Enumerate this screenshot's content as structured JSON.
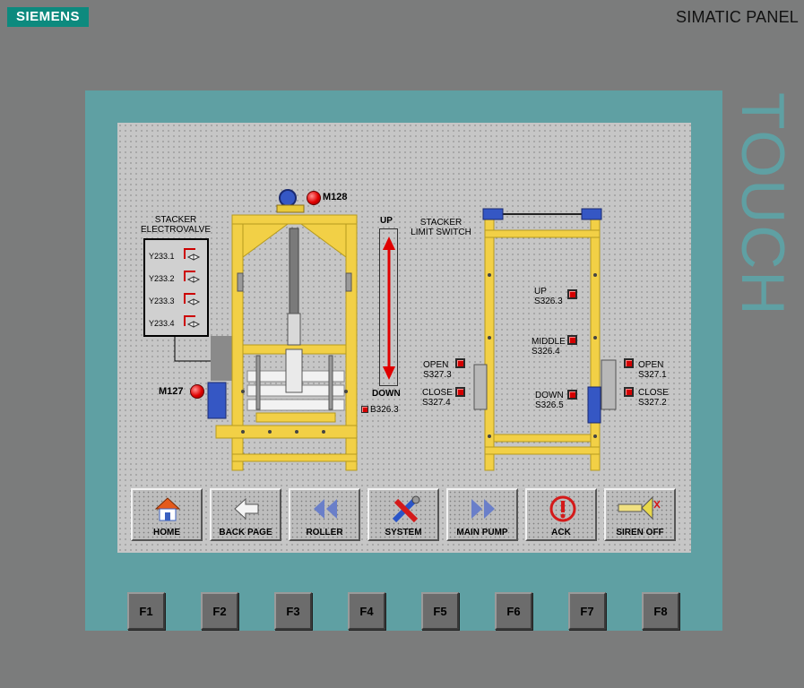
{
  "header": {
    "brand": "SIEMENS",
    "panel_title": "SIMATIC PANEL",
    "touch_label": "TOUCH"
  },
  "process": {
    "electrovalve_title_1": "STACKER",
    "electrovalve_title_2": "ELECTROVALVE",
    "valves": [
      "Y233.1",
      "Y233.2",
      "Y233.3",
      "Y233.4"
    ],
    "motors": {
      "m128": "M128",
      "m127": "M127"
    },
    "updown": {
      "up": "UP",
      "down": "DOWN",
      "sensor": "B326.3"
    },
    "limit_switch_title_1": "STACKER",
    "limit_switch_title_2": "LIMIT SWITCH",
    "switches": {
      "up": {
        "label": "UP",
        "code": "S326.3"
      },
      "middle": {
        "label": "MIDDLE",
        "code": "S326.4"
      },
      "down": {
        "label": "DOWN",
        "code": "S326.5"
      },
      "open_left": {
        "label": "OPEN",
        "code": "S327.3"
      },
      "close_left": {
        "label": "CLOSE",
        "code": "S327.4"
      },
      "open_right": {
        "label": "OPEN",
        "code": "S327.1"
      },
      "close_right": {
        "label": "CLOSE",
        "code": "S327.2"
      }
    },
    "status_colors": {
      "active": "#d40000",
      "frame": "#f2d046",
      "motor": "#3557c4"
    }
  },
  "nav_buttons": [
    {
      "label": "HOME",
      "icon": "home-icon"
    },
    {
      "label": "BACK PAGE",
      "icon": "back-arrow-icon"
    },
    {
      "label": "ROLLER",
      "icon": "rewind-icon"
    },
    {
      "label": "SYSTEM",
      "icon": "tools-icon"
    },
    {
      "label": "MAIN PUMP",
      "icon": "fast-forward-icon"
    },
    {
      "label": "ACK",
      "icon": "alarm-ack-icon"
    },
    {
      "label": "SIREN OFF",
      "icon": "siren-icon"
    }
  ],
  "function_keys": [
    "F1",
    "F2",
    "F3",
    "F4",
    "F5",
    "F6",
    "F7",
    "F8"
  ]
}
